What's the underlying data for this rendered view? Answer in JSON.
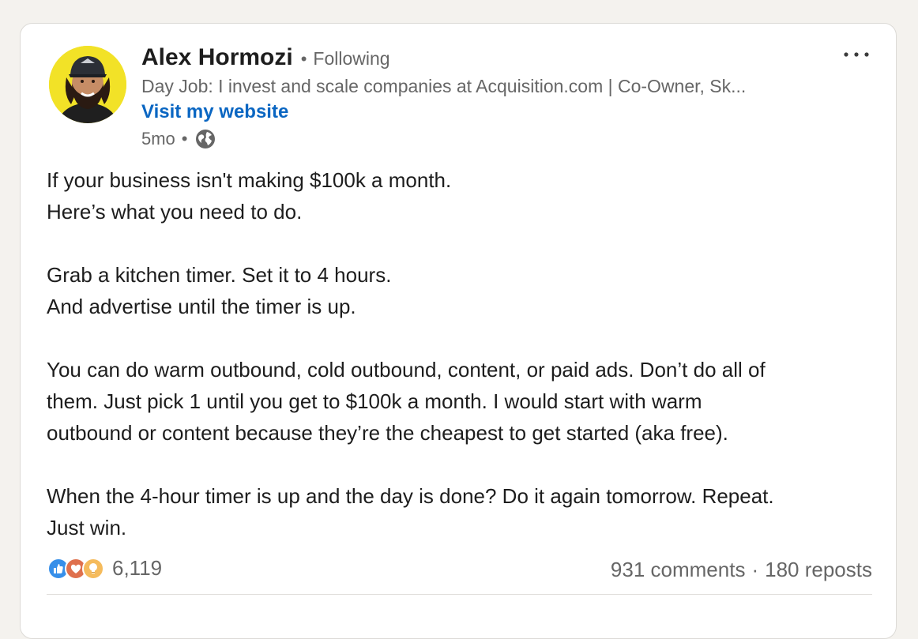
{
  "post": {
    "author": {
      "name": "Alex Hormozi",
      "follow_status": "Following",
      "headline": "Day Job: I invest and scale companies at Acquisition.com | Co-Owner, Sk...",
      "website_link": "Visit my website"
    },
    "meta": {
      "age": "5mo",
      "visibility_icon": "globe-icon"
    },
    "body": "If your business isn't making $100k a month.\nHere’s what you need to do.\n\nGrab a kitchen timer. Set it to 4 hours.\nAnd advertise until the timer is up.\n\nYou can do warm outbound, cold outbound, content, or paid ads. Don’t do all of\nthem. Just pick 1 until you get to $100k a month. I would start with warm\noutbound or content because they’re the cheapest to get started (aka free).\n\nWhen the 4-hour timer is up and the day is done? Do it again tomorrow. Repeat.\nJust win.",
    "reactions": {
      "icons": [
        "like-icon",
        "love-icon",
        "insightful-icon"
      ],
      "count": "6,119"
    },
    "engagement": {
      "comments": "931 comments",
      "reposts": "180 reposts"
    },
    "more_icon": "ellipsis-icon"
  },
  "colors": {
    "background": "#f4f2ee",
    "card": "#ffffff",
    "link": "#0a66c2",
    "secondary_text": "#666666",
    "primary_text": "#1d1d1d",
    "avatar_bg": "#f2e227"
  }
}
